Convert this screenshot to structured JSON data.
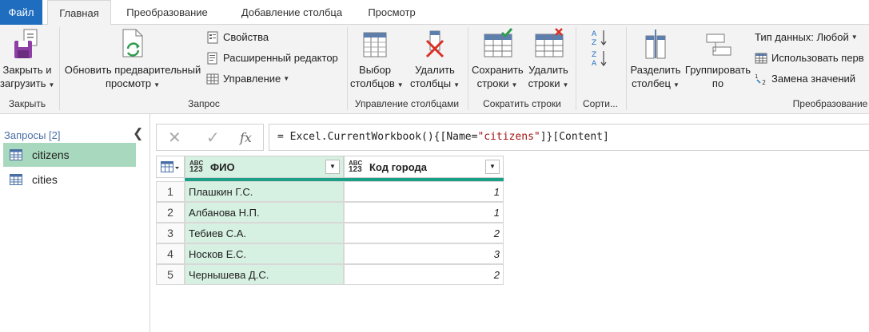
{
  "tabs": [
    {
      "label": "Файл"
    },
    {
      "label": "Главная"
    },
    {
      "label": "Преобразование"
    },
    {
      "label": "Добавление столбца"
    },
    {
      "label": "Просмотр"
    }
  ],
  "ribbon": {
    "close_group": {
      "btn_line1": "Закрыть и",
      "btn_line2": "загрузить",
      "label": "Закрыть"
    },
    "query_group": {
      "refresh_line1": "Обновить предварительный",
      "refresh_line2": "просмотр",
      "properties": "Свойства",
      "advanced_editor": "Расширенный редактор",
      "manage": "Управление",
      "label": "Запрос"
    },
    "columns_group": {
      "choose_line1": "Выбор",
      "choose_line2": "столбцов",
      "remove_line1": "Удалить",
      "remove_line2": "столбцы",
      "label": "Управление столбцами"
    },
    "rows_group": {
      "keep_line1": "Сохранить",
      "keep_line2": "строки",
      "remove_line1": "Удалить",
      "remove_line2": "строки",
      "label": "Сократить строки"
    },
    "sort_group": {
      "label": "Сорти..."
    },
    "transform_group": {
      "split_line1": "Разделить",
      "split_line2": "столбец",
      "group_line1": "Группировать",
      "group_line2": "по",
      "data_type": "Тип данных: Любой",
      "use_first_row": "Использовать перв",
      "replace_values": "Замена значений",
      "label": "Преобразование"
    }
  },
  "queries": {
    "header": "Запросы [2]",
    "items": [
      {
        "label": "citizens",
        "selected": true
      },
      {
        "label": "cities",
        "selected": false
      }
    ]
  },
  "formula_bar": {
    "fx": "fx",
    "prefix": "= Excel.CurrentWorkbook(){[Name=",
    "string": "\"citizens\"",
    "suffix": "]}[Content]"
  },
  "table": {
    "columns": [
      {
        "type_top": "ABC",
        "type_bottom": "123",
        "name": "ФИО"
      },
      {
        "type_top": "ABC",
        "type_bottom": "123",
        "name": "Код города"
      }
    ],
    "rows": [
      {
        "n": "1",
        "fio": "Плашкин Г.С.",
        "code": "1"
      },
      {
        "n": "2",
        "fio": "Албанова Н.П.",
        "code": "1"
      },
      {
        "n": "3",
        "fio": "Тебиев С.А.",
        "code": "2"
      },
      {
        "n": "4",
        "fio": "Носков Е.С.",
        "code": "3"
      },
      {
        "n": "5",
        "fio": "Чернышева Д.С.",
        "code": "2"
      }
    ]
  },
  "colors": {
    "file_tab": "#1f6dbf",
    "selected_query": "#a8d8bd",
    "selected_column": "#d6f0e1",
    "accent_bar": "#1aa086"
  }
}
